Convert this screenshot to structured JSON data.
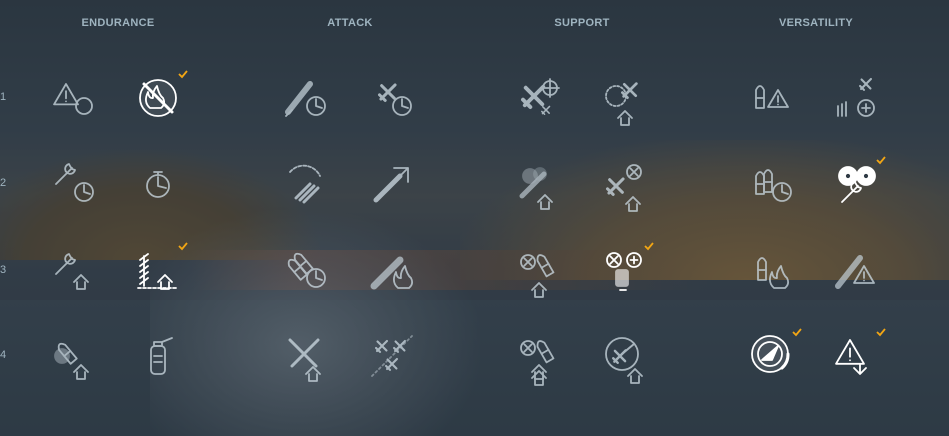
{
  "columns": [
    {
      "title": "ENDURANCE"
    },
    {
      "title": "ATTACK"
    },
    {
      "title": "SUPPORT"
    },
    {
      "title": "VERSATILITY"
    }
  ],
  "rows": [
    {
      "label": "1"
    },
    {
      "label": "2"
    },
    {
      "label": "3"
    },
    {
      "label": "4"
    }
  ],
  "colors": {
    "icon": "#c9d6de",
    "icon_selected": "#ffffff",
    "check": "#f2a614",
    "title": "#9fb4c0"
  },
  "skills": [
    {
      "col": 0,
      "row": 0,
      "slot": 0,
      "icon": "warning-circle-icon",
      "selected": false
    },
    {
      "col": 0,
      "row": 0,
      "slot": 1,
      "icon": "no-fire-icon",
      "selected": true
    },
    {
      "col": 0,
      "row": 1,
      "slot": 0,
      "icon": "wrench-timer-icon",
      "selected": false
    },
    {
      "col": 0,
      "row": 1,
      "slot": 1,
      "icon": "stopwatch-icon",
      "selected": false
    },
    {
      "col": 0,
      "row": 2,
      "slot": 0,
      "icon": "wrench-up-icon",
      "selected": false
    },
    {
      "col": 0,
      "row": 2,
      "slot": 1,
      "icon": "flooding-up-icon",
      "selected": true
    },
    {
      "col": 0,
      "row": 3,
      "slot": 0,
      "icon": "shell-impact-up-icon",
      "selected": false
    },
    {
      "col": 0,
      "row": 3,
      "slot": 1,
      "icon": "extinguisher-icon",
      "selected": false
    },
    {
      "col": 1,
      "row": 0,
      "slot": 0,
      "icon": "torpedo-timer-icon",
      "selected": false
    },
    {
      "col": 1,
      "row": 0,
      "slot": 1,
      "icon": "plane-timer-icon",
      "selected": false
    },
    {
      "col": 1,
      "row": 1,
      "slot": 0,
      "icon": "torpedo-spread-icon",
      "selected": false
    },
    {
      "col": 1,
      "row": 1,
      "slot": 1,
      "icon": "shell-range-up-icon",
      "selected": false
    },
    {
      "col": 1,
      "row": 2,
      "slot": 0,
      "icon": "shells-timer-icon",
      "selected": false
    },
    {
      "col": 1,
      "row": 2,
      "slot": 1,
      "icon": "shell-fire-icon",
      "selected": false
    },
    {
      "col": 1,
      "row": 3,
      "slot": 0,
      "icon": "crossed-shells-up-icon",
      "selected": false
    },
    {
      "col": 1,
      "row": 3,
      "slot": 1,
      "icon": "plane-squadron-icon",
      "selected": false
    },
    {
      "col": 2,
      "row": 0,
      "slot": 0,
      "icon": "plane-target-icon",
      "selected": false
    },
    {
      "col": 2,
      "row": 0,
      "slot": 1,
      "icon": "plane-radar-up-icon",
      "selected": false
    },
    {
      "col": 2,
      "row": 1,
      "slot": 0,
      "icon": "smoke-up-icon",
      "selected": false
    },
    {
      "col": 2,
      "row": 1,
      "slot": 1,
      "icon": "plane-repair-up-icon",
      "selected": false
    },
    {
      "col": 2,
      "row": 2,
      "slot": 0,
      "icon": "consumable-up-icon",
      "selected": false
    },
    {
      "col": 2,
      "row": 2,
      "slot": 1,
      "icon": "consumable-plus-icon",
      "selected": true
    },
    {
      "col": 2,
      "row": 3,
      "slot": 0,
      "icon": "consumable-double-up-icon",
      "selected": false
    },
    {
      "col": 2,
      "row": 3,
      "slot": 1,
      "icon": "radar-sweep-up-icon",
      "selected": false
    },
    {
      "col": 3,
      "row": 0,
      "slot": 0,
      "icon": "shell-warning-icon",
      "selected": false
    },
    {
      "col": 3,
      "row": 0,
      "slot": 1,
      "icon": "plane-bomb-plus-icon",
      "selected": false
    },
    {
      "col": 3,
      "row": 1,
      "slot": 0,
      "icon": "shells-timer-alt-icon",
      "selected": false
    },
    {
      "col": 3,
      "row": 1,
      "slot": 1,
      "icon": "gears-wrench-icon",
      "selected": true
    },
    {
      "col": 3,
      "row": 2,
      "slot": 0,
      "icon": "shell-fire-alt-icon",
      "selected": false
    },
    {
      "col": 3,
      "row": 2,
      "slot": 1,
      "icon": "torpedo-warning-icon",
      "selected": false
    },
    {
      "col": 3,
      "row": 3,
      "slot": 0,
      "icon": "radar-compass-icon",
      "selected": true
    },
    {
      "col": 3,
      "row": 3,
      "slot": 1,
      "icon": "warning-down-icon",
      "selected": true
    }
  ]
}
